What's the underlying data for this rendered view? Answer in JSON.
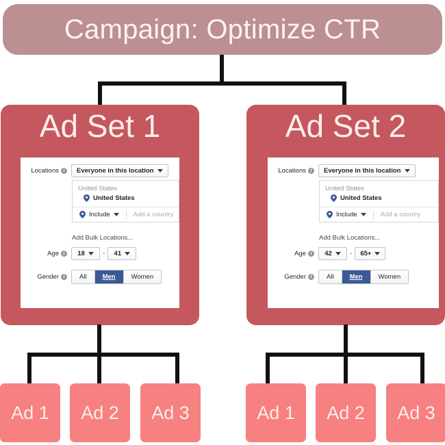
{
  "campaign": {
    "title": "Campaign: Optimize CTR"
  },
  "adsets": [
    {
      "title": "Ad Set 1",
      "form": {
        "locations_label": "Locations",
        "location_scope": "Everyone in this location",
        "location_group_header": "United States",
        "location_item": "United States",
        "include_label": "Include",
        "country_placeholder": "Add a country",
        "bulk_link": "Add Bulk Locations...",
        "age_label": "Age",
        "age_min": "18",
        "age_max": "41",
        "age_separator": "-",
        "gender_label": "Gender",
        "gender_options": [
          "All",
          "Men",
          "Women"
        ],
        "gender_selected": "Men"
      },
      "ads": [
        "Ad 1",
        "Ad 2",
        "Ad 3"
      ]
    },
    {
      "title": "Ad Set 2",
      "form": {
        "locations_label": "Locations",
        "location_scope": "Everyone in this location",
        "location_group_header": "United States",
        "location_item": "United States",
        "include_label": "Include",
        "country_placeholder": "Add a country",
        "bulk_link": "Add Bulk Locations...",
        "age_label": "Age",
        "age_min": "42",
        "age_max": "65+",
        "age_separator": "-",
        "gender_label": "Gender",
        "gender_options": [
          "All",
          "Men",
          "Women"
        ],
        "gender_selected": "Men"
      },
      "ads": [
        "Ad 1",
        "Ad 2",
        "Ad 3"
      ]
    }
  ],
  "colors": {
    "campaign_bg": "#bc8f92",
    "adset_bg": "#c4585e",
    "ad_bg": "#f78080",
    "connector": "#111111",
    "fb_blue": "#3b5998",
    "panel_bg": "#ffffff"
  },
  "icons": {
    "info": "i",
    "caret": "chevron-down-icon",
    "pin": "map-pin-icon"
  }
}
